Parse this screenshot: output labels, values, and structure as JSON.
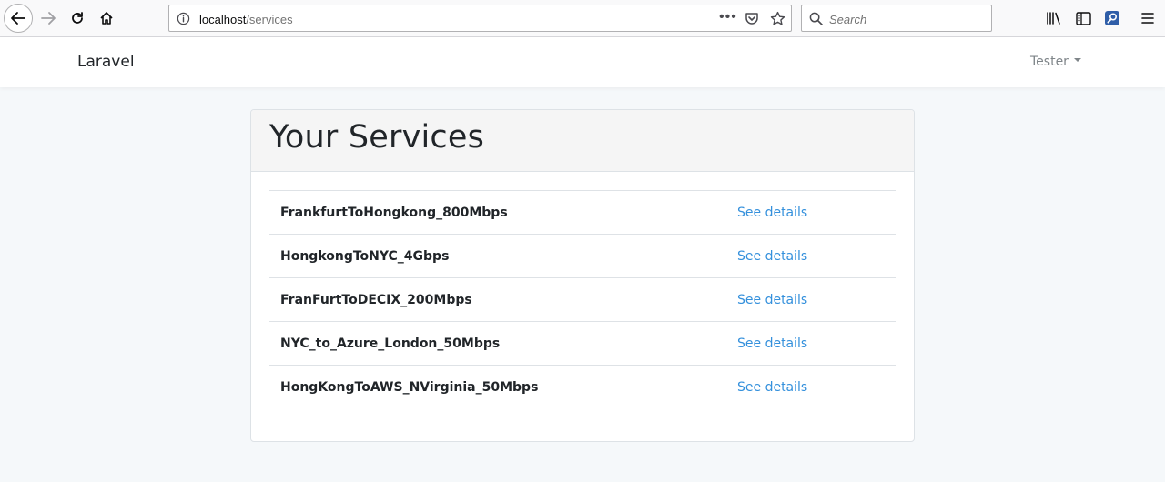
{
  "browser": {
    "url_host": "localhost",
    "url_path": "/services",
    "search_placeholder": "Search"
  },
  "navbar": {
    "brand": "Laravel",
    "user": "Tester"
  },
  "card": {
    "title": "Your Services",
    "services": [
      {
        "name": "FrankfurtToHongkong_800Mbps",
        "link": "See details"
      },
      {
        "name": "HongkongToNYC_4Gbps",
        "link": "See details"
      },
      {
        "name": "FranFurtToDECIX_200Mbps",
        "link": "See details"
      },
      {
        "name": "NYC_to_Azure_London_50Mbps",
        "link": "See details"
      },
      {
        "name": "HongKongToAWS_NVirginia_50Mbps",
        "link": "See details"
      }
    ]
  },
  "colors": {
    "link": "#3490dc",
    "page_bg": "#f5f8fa",
    "card_header_bg": "#f5f5f5"
  }
}
